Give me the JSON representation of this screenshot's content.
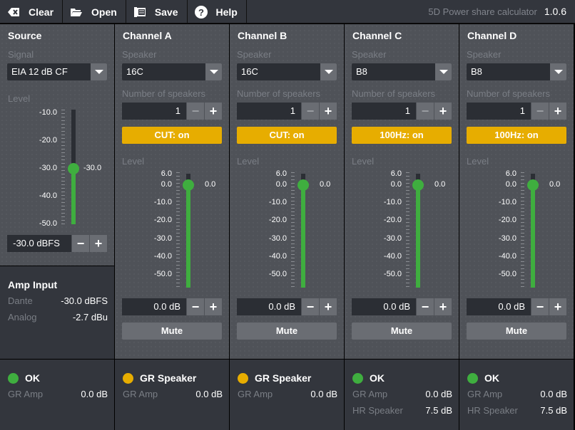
{
  "toolbar": {
    "clear": "Clear",
    "open": "Open",
    "save": "Save",
    "help": "Help",
    "app_name": "5D Power share calculator",
    "version": "1.0.6"
  },
  "source": {
    "title": "Source",
    "signal_label": "Signal",
    "signal_value": "EIA 12 dB CF",
    "level_label": "Level",
    "level_value": "-30.0",
    "level_input": "-30.0  dBFS",
    "ticks": [
      "-10.0",
      "-20.0",
      "-30.0",
      "-40.0",
      "-50.0"
    ],
    "level_db": -30
  },
  "amp_input": {
    "title": "Amp Input",
    "dante_label": "Dante",
    "dante_value": "-30.0 dBFS",
    "analog_label": "Analog",
    "analog_value": "-2.7 dBu"
  },
  "source_status": {
    "status": "OK",
    "color": "#3fae3f",
    "gr_amp_label": "GR Amp",
    "gr_amp_value": "0.0 dB"
  },
  "channel_ticks": [
    "6.0",
    "0.0",
    "-10.0",
    "-20.0",
    "-30.0",
    "-40.0",
    "-50.0"
  ],
  "channels": [
    {
      "title": "Channel A",
      "speaker_label": "Speaker",
      "speaker": "16C",
      "num_label": "Number of speakers",
      "num": "1",
      "filter": "CUT: on",
      "level_label": "Level",
      "level_value": "0.0",
      "level_db": 0,
      "gain": "0.0  dB",
      "mute": "Mute",
      "status": "GR Speaker",
      "status_color": "#e7ad00",
      "gr_amp_label": "GR Amp",
      "gr_amp": "0.0 dB",
      "hr_label": null,
      "hr": null
    },
    {
      "title": "Channel B",
      "speaker_label": "Speaker",
      "speaker": "16C",
      "num_label": "Number of speakers",
      "num": "1",
      "filter": "CUT: on",
      "level_label": "Level",
      "level_value": "0.0",
      "level_db": 0,
      "gain": "0.0  dB",
      "mute": "Mute",
      "status": "GR Speaker",
      "status_color": "#e7ad00",
      "gr_amp_label": "GR Amp",
      "gr_amp": "0.0 dB",
      "hr_label": null,
      "hr": null
    },
    {
      "title": "Channel C",
      "speaker_label": "Speaker",
      "speaker": "B8",
      "num_label": "Number of speakers",
      "num": "1",
      "filter": "100Hz: on",
      "level_label": "Level",
      "level_value": "0.0",
      "level_db": 0,
      "gain": "0.0  dB",
      "mute": "Mute",
      "status": "OK",
      "status_color": "#3fae3f",
      "gr_amp_label": "GR Amp",
      "gr_amp": "0.0 dB",
      "hr_label": "HR Speaker",
      "hr": "7.5 dB"
    },
    {
      "title": "Channel D",
      "speaker_label": "Speaker",
      "speaker": "B8",
      "num_label": "Number of speakers",
      "num": "1",
      "filter": "100Hz: on",
      "level_label": "Level",
      "level_value": "0.0",
      "level_db": 0,
      "gain": "0.0  dB",
      "mute": "Mute",
      "status": "OK",
      "status_color": "#3fae3f",
      "gr_amp_label": "GR Amp",
      "gr_amp": "0.0 dB",
      "hr_label": "HR Speaker",
      "hr": "7.5 dB"
    }
  ]
}
